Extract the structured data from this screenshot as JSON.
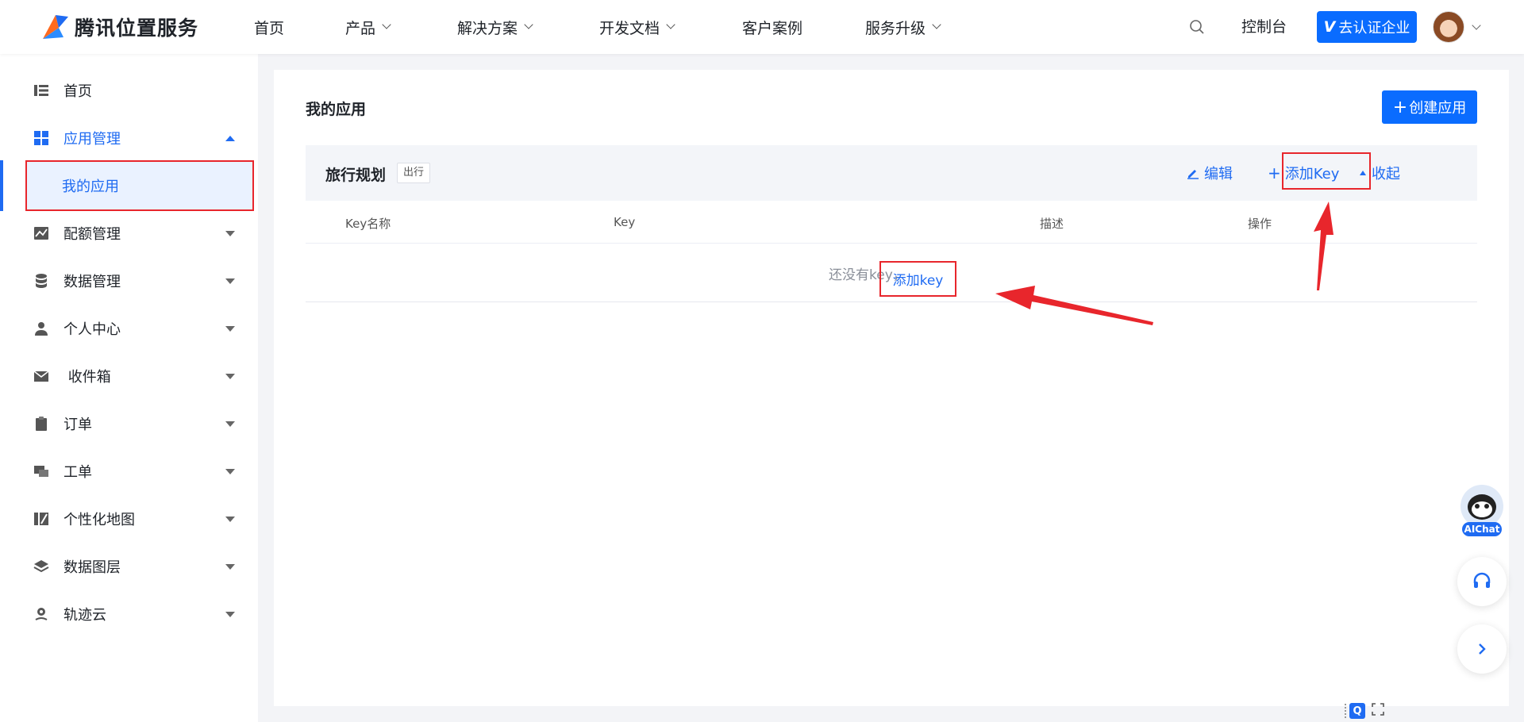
{
  "header": {
    "logo_text": "腾讯位置服务",
    "nav": [
      {
        "label": "首页",
        "dropdown": false
      },
      {
        "label": "产品",
        "dropdown": true
      },
      {
        "label": "解决方案",
        "dropdown": true
      },
      {
        "label": "开发文档",
        "dropdown": true
      },
      {
        "label": "客户案例",
        "dropdown": false
      },
      {
        "label": "服务升级",
        "dropdown": true
      }
    ],
    "console_label": "控制台",
    "verify_label": "去认证企业",
    "verify_prefix": "V"
  },
  "sidebar": {
    "items": [
      {
        "label": "首页",
        "icon": "list-icon"
      },
      {
        "label": "应用管理",
        "icon": "grid-icon",
        "expanded": true
      },
      {
        "label": "配额管理",
        "icon": "chart-icon"
      },
      {
        "label": "数据管理",
        "icon": "database-icon"
      },
      {
        "label": "个人中心",
        "icon": "person-icon"
      },
      {
        "label": " 收件箱",
        "icon": "mail-icon"
      },
      {
        "label": "订单",
        "icon": "clipboard-icon"
      },
      {
        "label": "工单",
        "icon": "ticket-icon"
      },
      {
        "label": "个性化地图",
        "icon": "map-style-icon"
      },
      {
        "label": "数据图层",
        "icon": "layers-icon"
      },
      {
        "label": "轨迹云",
        "icon": "track-icon"
      }
    ],
    "sub_active": "我的应用"
  },
  "main": {
    "title": "我的应用",
    "create_label": "创建应用",
    "app": {
      "name": "旅行规划",
      "tag": "出行",
      "edit_label": "编辑",
      "add_key_label": "添加Key",
      "collapse_label": "收起"
    },
    "table": {
      "columns": [
        "Key名称",
        "Key",
        "描述",
        "操作"
      ],
      "empty_text": "还没有key，",
      "empty_link": "添加key"
    }
  },
  "floating": {
    "ai_label": "AIChat",
    "mini_q": "Q"
  },
  "colors": {
    "brand_blue": "#0a6cff",
    "link_blue": "#1f6bf2",
    "highlight_red": "#e8262c"
  }
}
